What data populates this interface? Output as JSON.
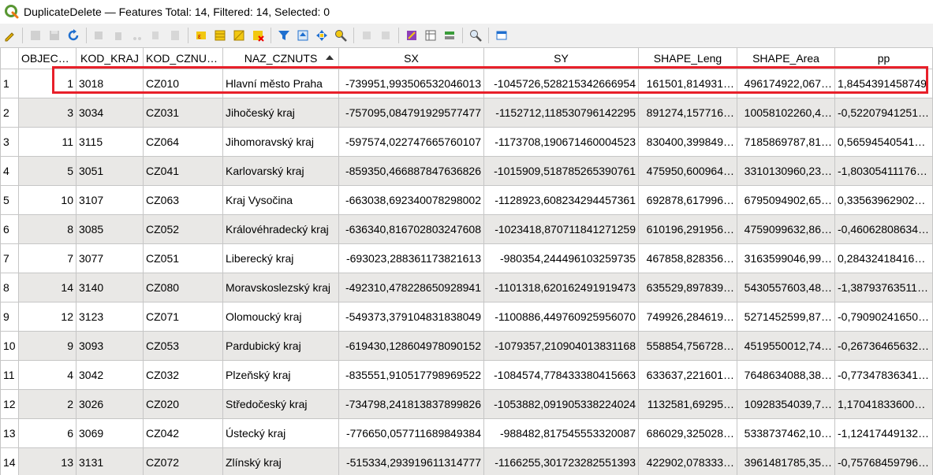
{
  "window": {
    "title": "DuplicateDelete — Features Total: 14, Filtered: 14, Selected: 0"
  },
  "toolbar": {
    "buttons": [
      {
        "name": "toggle-editing-icon",
        "disabled": false
      },
      {
        "name": "multi-edit-icon",
        "disabled": true
      },
      {
        "name": "save-edits-icon",
        "disabled": true
      },
      {
        "name": "reload-icon",
        "disabled": false
      },
      {
        "name": "add-feature-icon",
        "disabled": true
      },
      {
        "name": "delete-selected-icon",
        "disabled": true
      },
      {
        "name": "cut-icon",
        "disabled": true
      },
      {
        "name": "copy-icon",
        "disabled": true
      },
      {
        "name": "paste-icon",
        "disabled": true
      },
      {
        "name": "select-by-expression-icon",
        "disabled": false
      },
      {
        "name": "select-all-icon",
        "disabled": false
      },
      {
        "name": "invert-selection-icon",
        "disabled": false
      },
      {
        "name": "deselect-all-icon",
        "disabled": false
      },
      {
        "name": "filter-icon",
        "disabled": false
      },
      {
        "name": "move-selection-top-icon",
        "disabled": false
      },
      {
        "name": "pan-to-selected-icon",
        "disabled": false
      },
      {
        "name": "zoom-to-selected-icon",
        "disabled": false
      },
      {
        "name": "copy-cells-icon",
        "disabled": true
      },
      {
        "name": "paste-features-icon",
        "disabled": true
      },
      {
        "name": "field-calculator-icon",
        "disabled": false
      },
      {
        "name": "organize-columns-icon",
        "disabled": false
      },
      {
        "name": "conditional-formatting-icon",
        "disabled": false
      },
      {
        "name": "actions-icon",
        "disabled": false
      },
      {
        "name": "dock-icon",
        "disabled": false
      }
    ]
  },
  "table": {
    "columns": [
      "OBJECTID",
      "KOD_KRAJ",
      "KOD_CZNUTS",
      "NAZ_CZNUTS",
      "SX",
      "SY",
      "SHAPE_Leng",
      "SHAPE_Area",
      "pp"
    ],
    "rows": [
      {
        "n": "1",
        "c": [
          "1",
          "3018",
          "CZ010",
          "Hlavní město Praha",
          "-739951,993506532046013",
          "-1045726,528215342666954",
          "161501,814931…",
          "496174922,067…",
          "1,8454391458749"
        ]
      },
      {
        "n": "2",
        "c": [
          "3",
          "3034",
          "CZ031",
          "Jihočeský kraj",
          "-757095,084791929577477",
          "-1152712,118530796142295",
          "891274,157716…",
          "10058102260,4…",
          "-0,52207941251…"
        ]
      },
      {
        "n": "3",
        "c": [
          "11",
          "3115",
          "CZ064",
          "Jihomoravský kraj",
          "-597574,022747665760107",
          "-1173708,190671460004523",
          "830400,399849…",
          "7185869787,81…",
          "0,56594540541…"
        ]
      },
      {
        "n": "4",
        "c": [
          "5",
          "3051",
          "CZ041",
          "Karlovarský kraj",
          "-859350,466887847636826",
          "-1015909,518785265390761",
          "475950,600964…",
          "3310130960,23…",
          "-1,80305411176…"
        ]
      },
      {
        "n": "5",
        "c": [
          "10",
          "3107",
          "CZ063",
          "Kraj Vysočina",
          "-663038,692340078298002",
          "-1128923,608234294457361",
          "692878,617996…",
          "6795094902,65…",
          "0,33563962902…"
        ]
      },
      {
        "n": "6",
        "c": [
          "8",
          "3085",
          "CZ052",
          "Královéhradecký kraj",
          "-636340,816702803247608",
          "-1023418,870711841271259",
          "610196,291956…",
          "4759099632,86…",
          "-0,46062808634…"
        ]
      },
      {
        "n": "7",
        "c": [
          "7",
          "3077",
          "CZ051",
          "Liberecký kraj",
          "-693023,288361173821613",
          "-980354,244496103259735",
          "467858,828356…",
          "3163599046,99…",
          "0,28432418416…"
        ]
      },
      {
        "n": "8",
        "c": [
          "14",
          "3140",
          "CZ080",
          "Moravskoslezský kraj",
          "-492310,478228650928941",
          "-1101318,620162491919473",
          "635529,897839…",
          "5430557603,48…",
          "-1,38793763511…"
        ]
      },
      {
        "n": "9",
        "c": [
          "12",
          "3123",
          "CZ071",
          "Olomoucký kraj",
          "-549373,379104831838049",
          "-1100886,449760925956070",
          "749926,284619…",
          "5271452599,87…",
          "-0,79090241650…"
        ]
      },
      {
        "n": "10",
        "c": [
          "9",
          "3093",
          "CZ053",
          "Pardubický kraj",
          "-619430,128604978090152",
          "-1079357,210904013831168",
          "558854,756728…",
          "4519550012,74…",
          "-0,26736465632…"
        ]
      },
      {
        "n": "11",
        "c": [
          "4",
          "3042",
          "CZ032",
          "Plzeňský kraj",
          "-835551,910517798969522",
          "-1084574,778433380415663",
          "633637,221601…",
          "7648634088,38…",
          "-0,77347836341…"
        ]
      },
      {
        "n": "12",
        "c": [
          "2",
          "3026",
          "CZ020",
          "Středočeský kraj",
          "-734798,241813837899826",
          "-1053882,091905338224024",
          "1132581,69295…",
          "10928354039,7…",
          "1,17041833600…"
        ]
      },
      {
        "n": "13",
        "c": [
          "6",
          "3069",
          "CZ042",
          "Ústecký kraj",
          "-776650,057711689849384",
          "-988482,817545553320087",
          "686029,325028…",
          "5338737462,10…",
          "-1,12417449132…"
        ]
      },
      {
        "n": "14",
        "c": [
          "13",
          "3131",
          "CZ072",
          "Zlínský kraj",
          "-515334,293919611314777",
          "-1166255,301723282551393",
          "422902,078333…",
          "3961481785,35…",
          "-0,75768459796…"
        ]
      }
    ]
  }
}
